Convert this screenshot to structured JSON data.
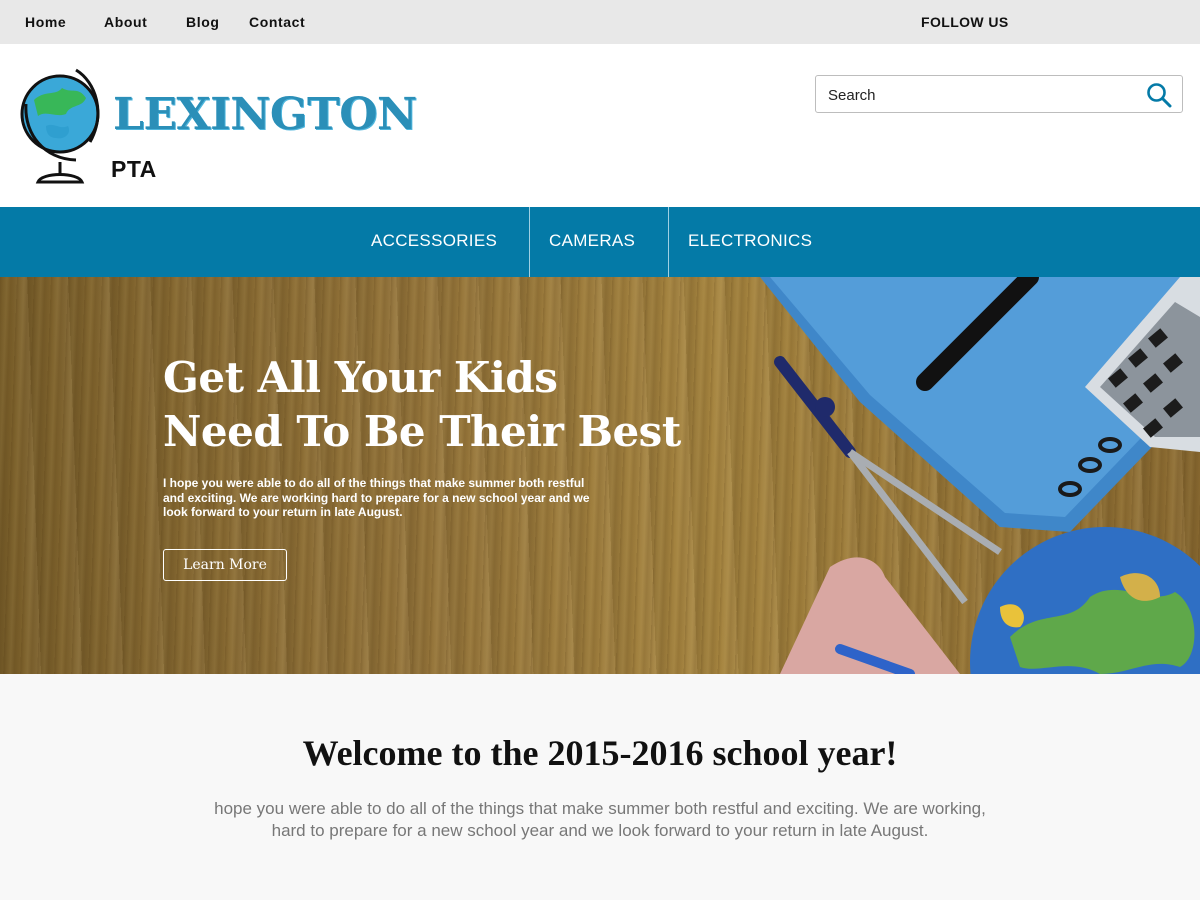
{
  "topbar": {
    "links": [
      "Home",
      "About",
      "Blog",
      "Contact"
    ],
    "follow_label": "FOLLOW US"
  },
  "header": {
    "logo_word": "LEXINGTON",
    "logo_sub": "PTA",
    "search": {
      "placeholder": "Search"
    }
  },
  "nav": {
    "items": [
      "ACCESSORIES",
      "CAMERAS",
      "ELECTRONICS"
    ]
  },
  "hero": {
    "title_line1": "Get All Your Kids",
    "title_line2": "Need To Be Their Best",
    "text": "I hope you were able to do all of the things that make summer both restful and exciting.  We are working hard to prepare for a new school year and we look forward to your return in late August.",
    "button_label": "Learn More"
  },
  "welcome": {
    "heading": "Welcome to the 2015-2016 school year!",
    "text_line1": "hope you were able to do all of the things that make summer both restful and exciting. We are working,",
    "text_line2": "hard to prepare for a new school year and we look forward to your return in late August."
  },
  "colors": {
    "nav_bg": "#047aa7",
    "logo_blue": "#2b8fb8",
    "topbar_bg": "#e8e8e8"
  },
  "icons": [
    "globe-logo-icon",
    "search-icon"
  ]
}
